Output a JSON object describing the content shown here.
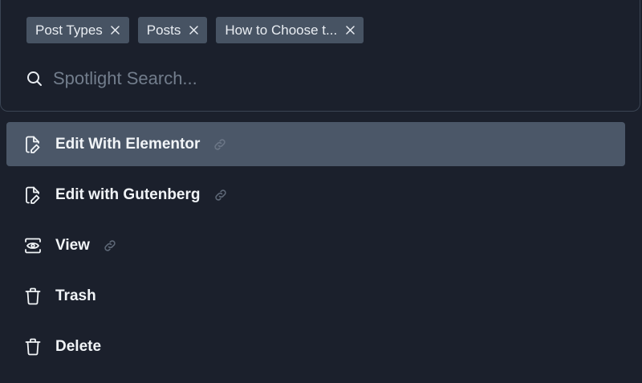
{
  "chips": [
    {
      "label": "Post Types"
    },
    {
      "label": "Posts"
    },
    {
      "label": "How to Choose t..."
    }
  ],
  "search": {
    "placeholder": "Spotlight Search..."
  },
  "menu": {
    "items": [
      {
        "label": "Edit With Elementor",
        "icon": "file-edit-icon",
        "has_link": true,
        "active": true
      },
      {
        "label": "Edit with Gutenberg",
        "icon": "file-edit-icon",
        "has_link": true,
        "active": false
      },
      {
        "label": "View",
        "icon": "eye-icon",
        "has_link": true,
        "active": false
      },
      {
        "label": "Trash",
        "icon": "trash-icon",
        "has_link": false,
        "active": false
      },
      {
        "label": "Delete",
        "icon": "trash-icon",
        "has_link": false,
        "active": false
      }
    ]
  },
  "colors": {
    "background": "#1b202c",
    "chip": "#475363",
    "active_item": "#4b5768",
    "text": "#f1f4f7",
    "placeholder": "#727d8c",
    "link_icon": "#5e6877"
  }
}
